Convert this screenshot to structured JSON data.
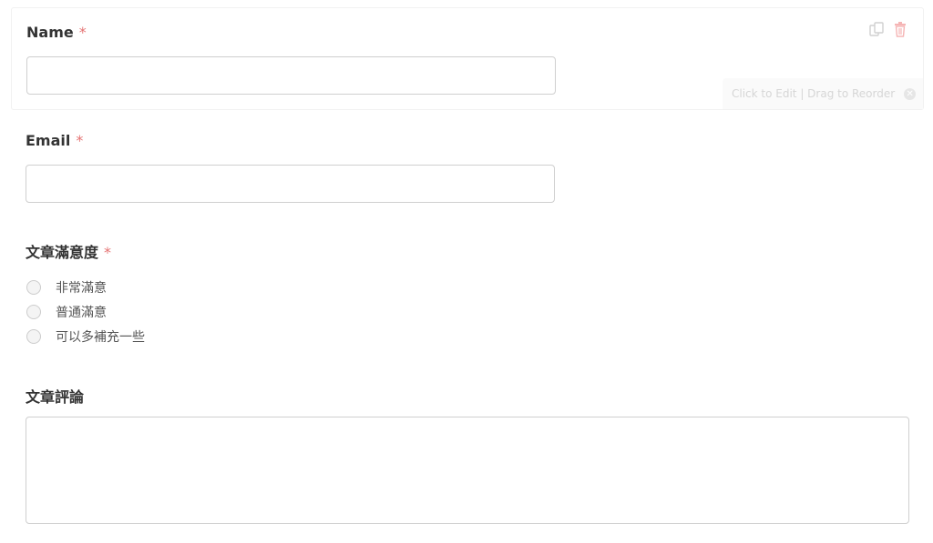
{
  "form": {
    "name_field": {
      "label": "Name",
      "required_mark": "*",
      "value": ""
    },
    "email_field": {
      "label": "Email",
      "required_mark": "*",
      "value": ""
    },
    "satisfaction_field": {
      "label": "文章滿意度",
      "required_mark": "*",
      "options": [
        "非常滿意",
        "普通滿意",
        "可以多補充一些"
      ]
    },
    "comment_field": {
      "label": "文章評論",
      "value": ""
    }
  },
  "editor": {
    "hint_text": "Click to Edit | Drag to Reorder",
    "close_symbol": "✕",
    "icons": [
      "duplicate-icon",
      "trash-icon"
    ],
    "colors": {
      "required": "#e57373",
      "trash": "#f5b5b5",
      "duplicate": "#d0d0d0"
    }
  }
}
